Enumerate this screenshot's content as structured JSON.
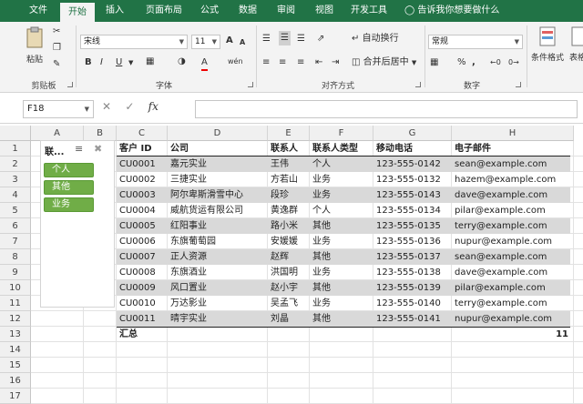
{
  "ribbon_tabs": [
    {
      "label": "文件"
    },
    {
      "label": "开始"
    },
    {
      "label": "插入"
    },
    {
      "label": "页面布局"
    },
    {
      "label": "公式"
    },
    {
      "label": "数据"
    },
    {
      "label": "审阅"
    },
    {
      "label": "视图"
    },
    {
      "label": "开发工具"
    }
  ],
  "active_tab": "开始",
  "tell_me": "告诉我你想要做什么",
  "clipboard": {
    "paste": "粘贴",
    "group": "剪贴板"
  },
  "font": {
    "name": "宋线",
    "size": "11",
    "grow": "A",
    "shrink": "A",
    "bold": "B",
    "italic": "I",
    "underline": "U",
    "font_color": "A",
    "wen": "wén",
    "group": "字体"
  },
  "alignment": {
    "wrap": "自动换行",
    "merge": "合并后居中",
    "group": "对齐方式"
  },
  "number": {
    "format": "常规",
    "percent": "%",
    "comma": ",",
    "group": "数字"
  },
  "styles": {
    "conditional": "条件格式",
    "table": "表格"
  },
  "formula_bar": {
    "name_box": "F18",
    "fx": "fx"
  },
  "columns": [
    "A",
    "B",
    "C",
    "D",
    "E",
    "F",
    "G",
    "H"
  ],
  "rows": [
    "1",
    "2",
    "3",
    "4",
    "5",
    "6",
    "7",
    "8",
    "9",
    "10",
    "11",
    "12",
    "13",
    "14",
    "15",
    "16",
    "17"
  ],
  "slicer": {
    "title": "联...",
    "items": [
      "个人",
      "其他",
      "业务"
    ]
  },
  "table": {
    "headers": [
      "客户 ID",
      "公司",
      "联系人",
      "联系人类型",
      "移动电话",
      "电子邮件"
    ],
    "rows": [
      [
        "CU0001",
        "嘉元实业",
        "王伟",
        "个人",
        "123-555-0142",
        "sean@example.com"
      ],
      [
        "CU0002",
        "三捷实业",
        "方若山",
        "业务",
        "123-555-0132",
        "hazem@example.com"
      ],
      [
        "CU0003",
        "阿尔卑斯滑雪中心",
        "段珍",
        "业务",
        "123-555-0143",
        "dave@example.com"
      ],
      [
        "CU0004",
        "威航货运有限公司",
        "黄逸群",
        "个人",
        "123-555-0134",
        "pilar@example.com"
      ],
      [
        "CU0005",
        "红阳事业",
        "路小米",
        "其他",
        "123-555-0135",
        "terry@example.com"
      ],
      [
        "CU0006",
        "东旗葡萄园",
        "安媛媛",
        "业务",
        "123-555-0136",
        "nupur@example.com"
      ],
      [
        "CU0007",
        "正人资源",
        "赵辉",
        "其他",
        "123-555-0137",
        "sean@example.com"
      ],
      [
        "CU0008",
        "东旗酒业",
        "洪国明",
        "业务",
        "123-555-0138",
        "dave@example.com"
      ],
      [
        "CU0009",
        "风口置业",
        "赵小宇",
        "其他",
        "123-555-0139",
        "pilar@example.com"
      ],
      [
        "CU0010",
        "万达影业",
        "吴孟飞",
        "业务",
        "123-555-0140",
        "terry@example.com"
      ],
      [
        "CU0011",
        "晴宇实业",
        "刘晶",
        "其他",
        "123-555-0141",
        "nupur@example.com"
      ]
    ],
    "total_label": "汇总",
    "total_value": "11"
  }
}
